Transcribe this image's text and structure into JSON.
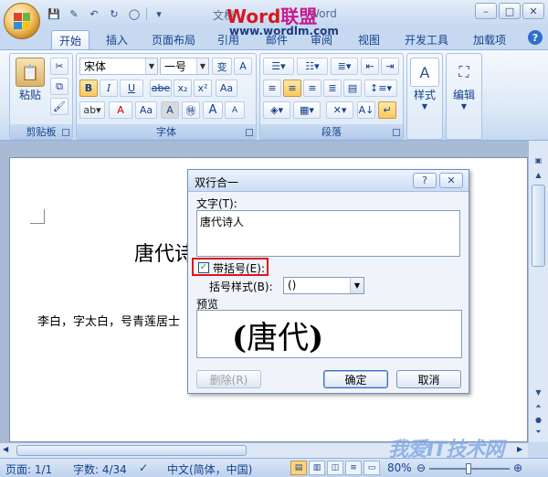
{
  "window": {
    "title_left": "文档",
    "title_right": "Word",
    "watermark_brand_1": "Word",
    "watermark_brand_2": "联盟",
    "watermark_url": "www.wordlm.com",
    "controls": [
      "–",
      "□",
      "✕"
    ]
  },
  "tabs": [
    {
      "label": "开始",
      "active": true
    },
    {
      "label": "插入"
    },
    {
      "label": "页面布局"
    },
    {
      "label": "引用"
    },
    {
      "label": "邮件"
    },
    {
      "label": "审阅"
    },
    {
      "label": "视图"
    },
    {
      "label": "开发工具"
    },
    {
      "label": "加载项"
    }
  ],
  "ribbon": {
    "clipboard": {
      "paste_label": "粘贴",
      "group_label": "剪贴板"
    },
    "font": {
      "font_name": "宋体",
      "font_size": "一号",
      "group_label": "字体",
      "bold": "B",
      "italic": "I",
      "underline": "U",
      "strike": "abe",
      "subscript": "x₂",
      "superscript": "x²",
      "font_color": "A",
      "case": "Aa",
      "grow": "A",
      "shrink": "A"
    },
    "paragraph": {
      "group_label": "段落"
    },
    "styles": {
      "label": "样式"
    },
    "editing": {
      "label": "编辑"
    }
  },
  "document": {
    "heading": "唐代诗",
    "body_line": "李白，字太白，号青莲居士"
  },
  "dialog": {
    "title": "双行合一",
    "help_btn": "?",
    "close_btn": "✕",
    "text_label": "文字(T):",
    "text_value": "唐代诗人",
    "bracket_checkbox_label": "带括号(E):",
    "bracket_checked": true,
    "bracket_style_label": "括号样式(B):",
    "bracket_style_value": "()",
    "preview_label": "预览",
    "preview_left_bracket": "(",
    "preview_text": "唐代",
    "preview_right_bracket": ")",
    "delete_btn": "删除(R)",
    "ok_btn": "确定",
    "cancel_btn": "取消"
  },
  "status": {
    "page": "页面: 1/1",
    "words": "字数: 4/34",
    "language": "中文(简体，中国)",
    "zoom": "80%"
  },
  "watermark_bottom": "我爱IT技术网"
}
